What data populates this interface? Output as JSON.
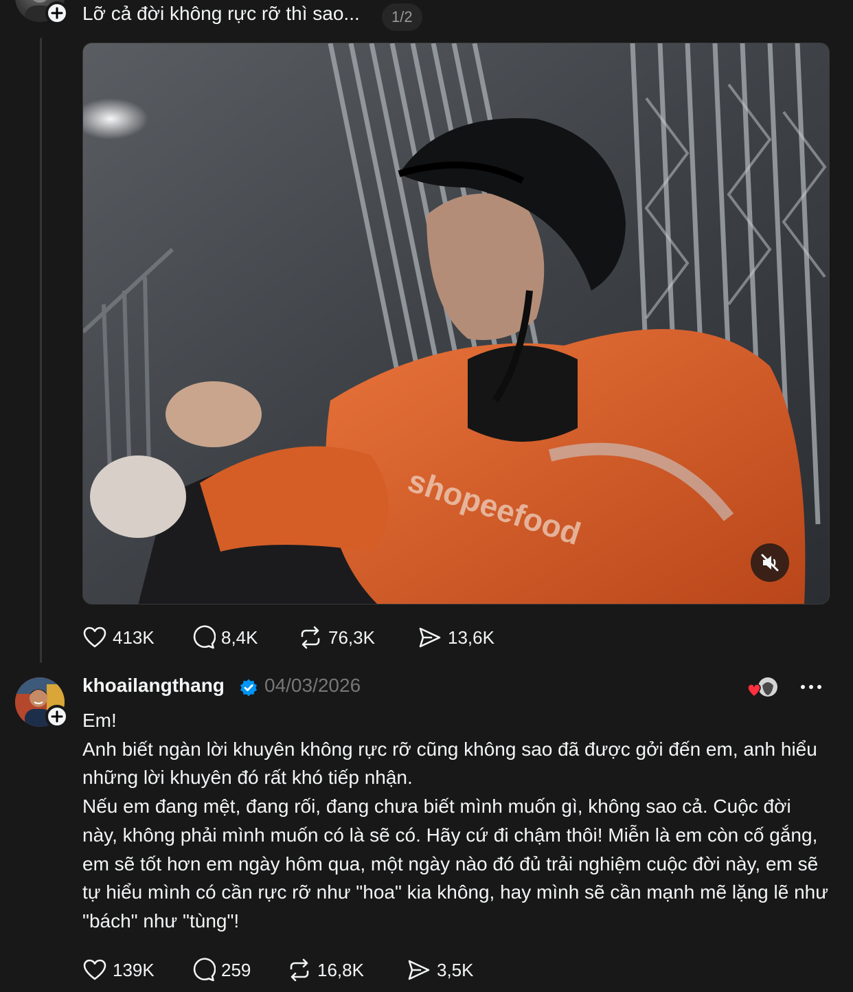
{
  "post1": {
    "text": "Lỡ cả đời không rực rỡ thì sao...",
    "media_counter": "1/2",
    "video_muted": true,
    "actions": {
      "likes": "413K",
      "replies": "8,4K",
      "reposts": "76,3K",
      "shares": "13,6K"
    }
  },
  "post2": {
    "username": "khoailangthang",
    "verified": true,
    "date": "04/03/2026",
    "body": [
      "Em!",
      "Anh biết ngàn lời khuyên không rực rỡ cũng không sao đã được gởi đến em, anh hiểu những lời khuyên đó rất khó tiếp nhận.",
      "Nếu em đang mệt, đang rối, đang chưa biết mình muốn gì, không sao cả. Cuộc đời này, không phải mình muốn có là sẽ có. Hãy cứ đi chậm thôi! Miễn là em còn cố gắng, em sẽ tốt hơn em ngày hôm qua, một ngày nào đó đủ trải nghiệm cuộc đời này, em sẽ tự hiểu mình có cần rực rỡ như \"hoa\" kia không, hay mình sẽ cần mạnh mẽ lặng lẽ như \"bách\" như \"tùng\"!"
    ],
    "actions": {
      "likes": "139K",
      "replies": "259",
      "reposts": "16,8K",
      "shares": "3,5K"
    }
  },
  "icons": {
    "like": "heart-icon",
    "reply": "comment-bubble-icon",
    "repost": "repost-arrows-icon",
    "share": "send-paper-plane-icon",
    "verified": "verified-badge-icon",
    "more": "more-dots-icon",
    "mute": "speaker-muted-icon",
    "follow": "plus-icon"
  },
  "colors": {
    "background": "#181818",
    "text": "#f3f5f7",
    "muted_text": "#777777",
    "verified_blue": "#0095f6",
    "like_red": "#ff3040",
    "jacket_orange": "#d95a1c"
  }
}
